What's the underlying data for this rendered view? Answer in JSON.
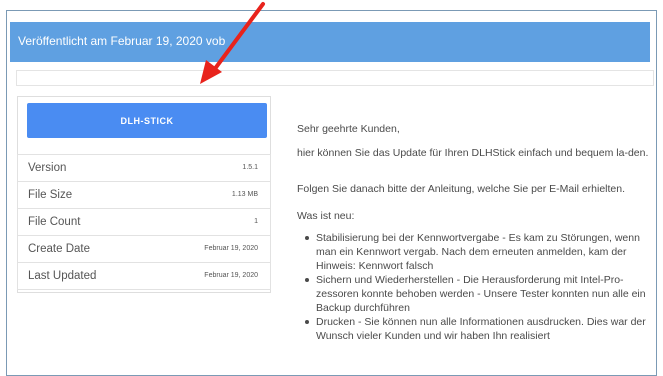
{
  "header": {
    "published": "Veröffentlicht am Februar 19, 2020 vob"
  },
  "download": {
    "button_label": "DLH-STICK"
  },
  "file_info": {
    "rows": [
      {
        "label": "Version",
        "value": "1.5.1"
      },
      {
        "label": "File Size",
        "value": "1.13 MB"
      },
      {
        "label": "File Count",
        "value": "1"
      },
      {
        "label": "Create Date",
        "value": "Februar 19, 2020"
      },
      {
        "label": "Last Updated",
        "value": "Februar 19, 2020"
      }
    ]
  },
  "article": {
    "greeting": "Sehr geehrte Kunden,",
    "intro": "hier können Sie das Update für Ihren DLHStick einfach und bequem la-den.",
    "instructions": "Folgen Sie danach bitte der Anleitung, welche Sie per E-Mail erhielten.",
    "whats_new_heading": "Was ist neu:",
    "bullets": [
      "Stabilisierung bei der Kennwortvergabe - Es kam zu Störungen, wenn man ein Kennwort vergab. Nach dem erneuten anmelden, kam der Hinweis: Kennwort falsch",
      "Sichern und Wiederherstellen - Die Herausforderung mit Intel-Pro-zessoren konnte behoben werden - Unsere Tester konnten nun alle ein Backup durchführen",
      "Drucken - Sie können nun alle Informationen ausdrucken. Dies war der Wunsch vieler Kunden und wir haben Ihn realisiert"
    ]
  },
  "annotation": {
    "arrow_color": "#e8231c"
  },
  "colors": {
    "banner": "#5fa0e1",
    "button": "#4a8cf2"
  }
}
